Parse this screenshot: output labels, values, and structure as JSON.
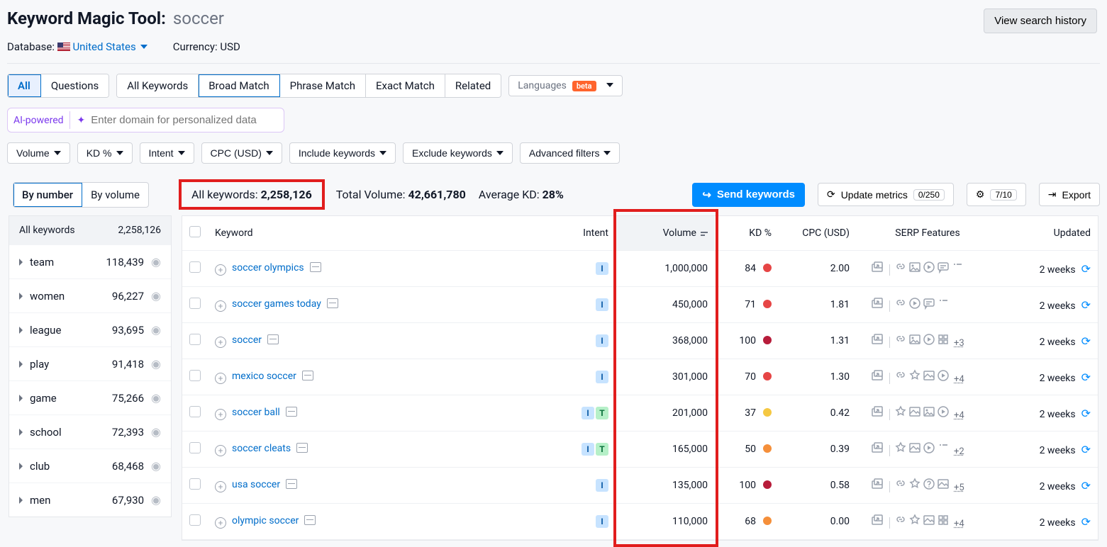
{
  "header": {
    "tool_title": "Keyword Magic Tool:",
    "query": "soccer",
    "history_button": "View search history",
    "database_label": "Database:",
    "database_value": "United States",
    "currency_label": "Currency:",
    "currency_value": "USD"
  },
  "tabs": {
    "scope": [
      "All",
      "Questions"
    ],
    "scope_active": "All",
    "match": [
      "All Keywords",
      "Broad Match",
      "Phrase Match",
      "Exact Match",
      "Related"
    ],
    "match_active": "Broad Match",
    "languages_label": "Languages",
    "beta": "beta"
  },
  "ai": {
    "label": "AI-powered",
    "placeholder": "Enter domain for personalized data"
  },
  "filters": [
    "Volume",
    "KD %",
    "Intent",
    "CPC (USD)",
    "Include keywords",
    "Exclude keywords",
    "Advanced filters"
  ],
  "view_toggle": {
    "by_number": "By number",
    "by_volume": "By volume",
    "active": "By number"
  },
  "stats": {
    "all_keywords_label": "All keywords:",
    "all_keywords_value": "2,258,126",
    "total_volume_label": "Total Volume:",
    "total_volume_value": "42,661,780",
    "avg_kd_label": "Average KD:",
    "avg_kd_value": "28%"
  },
  "actions": {
    "send": "Send keywords",
    "update": "Update metrics",
    "update_count": "0/250",
    "credits": "7/10",
    "export": "Export"
  },
  "sidebar": {
    "head_label": "All keywords",
    "head_count": "2,258,126",
    "items": [
      {
        "name": "team",
        "count": "118,439"
      },
      {
        "name": "women",
        "count": "96,227"
      },
      {
        "name": "league",
        "count": "93,695"
      },
      {
        "name": "play",
        "count": "91,418"
      },
      {
        "name": "game",
        "count": "75,266"
      },
      {
        "name": "school",
        "count": "72,393"
      },
      {
        "name": "club",
        "count": "68,468"
      },
      {
        "name": "men",
        "count": "67,930"
      }
    ]
  },
  "table": {
    "columns": {
      "keyword": "Keyword",
      "intent": "Intent",
      "volume": "Volume",
      "kd": "KD %",
      "cpc": "CPC (USD)",
      "serp": "SERP Features",
      "updated": "Updated"
    },
    "rows": [
      {
        "keyword": "soccer olympics",
        "intents": [
          "I"
        ],
        "volume": "1,000,000",
        "kd": "84",
        "kd_color": "#e64545",
        "cpc": "2.00",
        "serp_icons": [
          "popup",
          "link",
          "image",
          "video",
          "chat",
          "list"
        ],
        "serp_more": "",
        "updated": "2 weeks"
      },
      {
        "keyword": "soccer games today",
        "intents": [
          "I"
        ],
        "volume": "450,000",
        "kd": "71",
        "kd_color": "#e64545",
        "cpc": "1.81",
        "serp_icons": [
          "popup",
          "link",
          "video",
          "chat",
          "list"
        ],
        "serp_more": "",
        "updated": "2 weeks"
      },
      {
        "keyword": "soccer",
        "intents": [
          "I"
        ],
        "volume": "368,000",
        "kd": "100",
        "kd_color": "#b71c3a",
        "cpc": "1.31",
        "serp_icons": [
          "popup",
          "link",
          "image",
          "video",
          "grid"
        ],
        "serp_more": "+3",
        "updated": "2 weeks"
      },
      {
        "keyword": "mexico soccer",
        "intents": [
          "I"
        ],
        "volume": "301,000",
        "kd": "70",
        "kd_color": "#e64545",
        "cpc": "1.30",
        "serp_icons": [
          "popup",
          "link",
          "star",
          "imgbox",
          "video"
        ],
        "serp_more": "+4",
        "updated": "2 weeks"
      },
      {
        "keyword": "soccer ball",
        "intents": [
          "I",
          "T"
        ],
        "volume": "201,000",
        "kd": "37",
        "kd_color": "#f5c842",
        "cpc": "0.42",
        "serp_icons": [
          "popup",
          "star",
          "imgbox",
          "image",
          "video"
        ],
        "serp_more": "+4",
        "updated": "2 weeks"
      },
      {
        "keyword": "soccer cleats",
        "intents": [
          "I",
          "T"
        ],
        "volume": "165,000",
        "kd": "50",
        "kd_color": "#f58f3a",
        "cpc": "0.39",
        "serp_icons": [
          "popup",
          "star",
          "imgbox",
          "video",
          "list"
        ],
        "serp_more": "+2",
        "updated": "2 weeks"
      },
      {
        "keyword": "usa soccer",
        "intents": [
          "I"
        ],
        "volume": "135,000",
        "kd": "100",
        "kd_color": "#b71c3a",
        "cpc": "0.58",
        "serp_icons": [
          "popup",
          "link",
          "star",
          "help",
          "imgbox"
        ],
        "serp_more": "+5",
        "updated": "2 weeks"
      },
      {
        "keyword": "olympic soccer",
        "intents": [
          "I"
        ],
        "volume": "110,000",
        "kd": "68",
        "kd_color": "#f58f3a",
        "cpc": "0.00",
        "serp_icons": [
          "popup",
          "link",
          "star",
          "imgbox",
          "grid"
        ],
        "serp_more": "+4",
        "updated": "2 weeks"
      }
    ]
  }
}
